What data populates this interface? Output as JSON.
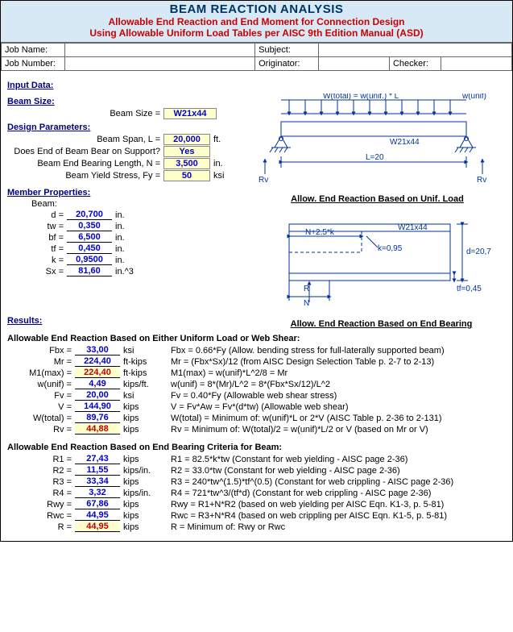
{
  "title": {
    "line1": "BEAM REACTION ANALYSIS",
    "line2": "Allowable End Reaction and End Moment for Connection Design",
    "line3": "Using Allowable Uniform Load Tables per AISC 9th Edition Manual (ASD)"
  },
  "header": {
    "jobName_l": "Job Name:",
    "jobName": "",
    "subject_l": "Subject:",
    "subject": "",
    "jobNumber_l": "Job Number:",
    "jobNumber": "",
    "originator_l": "Originator:",
    "originator": "",
    "checker_l": "Checker:",
    "checker": ""
  },
  "sections": {
    "input": "Input Data:",
    "beamSize": "Beam Size:",
    "designParams": "Design Parameters:",
    "memberProps": "Member Properties:",
    "beamLbl": "Beam:",
    "results": "Results:",
    "resA": "Allowable End Reaction Based on Either Uniform Load or Web Shear:",
    "resB": "Allowable End Reaction Based on End Bearing Criteria for Beam:"
  },
  "diag": {
    "cap1": "Allow. End Reaction Based on Unif. Load",
    "cap2": "Allow. End Reaction Based on End Bearing",
    "wtotal": "W(total) = w(unif.) * L",
    "wunif": "w(unif)",
    "size": "W21x44",
    "L": "L=20",
    "Rv": "Rv",
    "Nk": "N+2.5*k",
    "k": "k=0,95",
    "d": "d=20,7",
    "tf": "tf=0,45",
    "Rlab": "R",
    "Nlab": "N"
  },
  "inputs": {
    "beamSize": {
      "label": "Beam Size =",
      "value": "W21x44",
      "units": ""
    },
    "L": {
      "label": "Beam Span, L =",
      "value": "20,000",
      "units": "ft."
    },
    "bear": {
      "label": "Does End of Beam Bear on Support?",
      "value": "Yes",
      "units": ""
    },
    "N": {
      "label": "Beam End Bearing Length, N =",
      "value": "3,500",
      "units": "in."
    },
    "Fy": {
      "label": "Beam Yield Stress, Fy =",
      "value": "50",
      "units": "ksi"
    }
  },
  "props": {
    "d": {
      "label": "d =",
      "value": "20,700",
      "units": "in."
    },
    "tw": {
      "label": "tw =",
      "value": "0,350",
      "units": "in."
    },
    "bf": {
      "label": "bf =",
      "value": "6,500",
      "units": "in."
    },
    "tf": {
      "label": "tf =",
      "value": "0,450",
      "units": "in."
    },
    "k": {
      "label": "k =",
      "value": "0,9500",
      "units": "in."
    },
    "Sx": {
      "label": "Sx =",
      "value": "81,60",
      "units": "in.^3"
    }
  },
  "resA": {
    "Fbx": {
      "label": "Fbx =",
      "value": "33,00",
      "units": "ksi",
      "desc": "Fbx = 0.66*Fy  (Allow. bending stress for full-laterally supported beam)"
    },
    "Mr": {
      "label": "Mr =",
      "value": "224,40",
      "units": "ft-kips",
      "desc": "Mr = (Fbx*Sx)/12  (from AISC Design Selection Table p. 2-7 to 2-13)"
    },
    "M1": {
      "label": "M1(max) =",
      "value": "224,40",
      "units": "ft-kips",
      "desc": "M1(max) = w(unif)*L^2/8 = Mr",
      "hi": true
    },
    "wunif": {
      "label": "w(unif) =",
      "value": "4,49",
      "units": "kips/ft.",
      "desc": "w(unif) = 8*(Mr)/L^2 = 8*(Fbx*Sx/12)/L^2"
    },
    "Fv": {
      "label": "Fv =",
      "value": "20,00",
      "units": "ksi",
      "desc": "Fv = 0.40*Fy  (Allowable web shear stress)"
    },
    "V": {
      "label": "V =",
      "value": "144,90",
      "units": "kips",
      "desc": "V = Fv*Aw = Fv*(d*tw)  (Allowable web shear)"
    },
    "Wtot": {
      "label": "W(total) =",
      "value": "89,76",
      "units": "kips",
      "desc": "W(total) = Minimum of:  w(unif)*L or 2*V  (AISC Table p. 2-36 to 2-131)"
    },
    "Rv": {
      "label": "Rv =",
      "value": "44,88",
      "units": "kips",
      "desc": "Rv = Minimum of:  W(total)/2 = w(unif)*L/2  or  V  (based on Mr or V)",
      "hi": true
    }
  },
  "resB": {
    "R1": {
      "label": "R1 =",
      "value": "27,43",
      "units": "kips",
      "desc": "R1 = 82.5*k*tw  (Constant for web yielding - AISC page 2-36)"
    },
    "R2": {
      "label": "R2 =",
      "value": "11,55",
      "units": "kips/in.",
      "desc": "R2 = 33.0*tw  (Constant for web yielding - AISC page 2-36)"
    },
    "R3": {
      "label": "R3 =",
      "value": "33,34",
      "units": "kips",
      "desc": "R3 = 240*tw^(1.5)*tf^(0.5)  (Constant for web crippling - AISC page 2-36)"
    },
    "R4": {
      "label": "R4 =",
      "value": "3,32",
      "units": "kips/in.",
      "desc": "R4 = 721*tw^3/(tf*d)  (Constant for web crippling - AISC page 2-36)"
    },
    "Rwy": {
      "label": "Rwy =",
      "value": "67,86",
      "units": "kips",
      "desc": "Rwy = R1+N*R2  (based on web yielding per AISC Eqn. K1-3, p. 5-81)"
    },
    "Rwc": {
      "label": "Rwc =",
      "value": "44,95",
      "units": "kips",
      "desc": "Rwc = R3+N*R4  (based on web crippling per AISC Eqn. K1-5, p. 5-81)"
    },
    "R": {
      "label": "R =",
      "value": "44,95",
      "units": "kips",
      "desc": "R = Minimum of:  Rwy  or  Rwc",
      "hi": true
    }
  }
}
